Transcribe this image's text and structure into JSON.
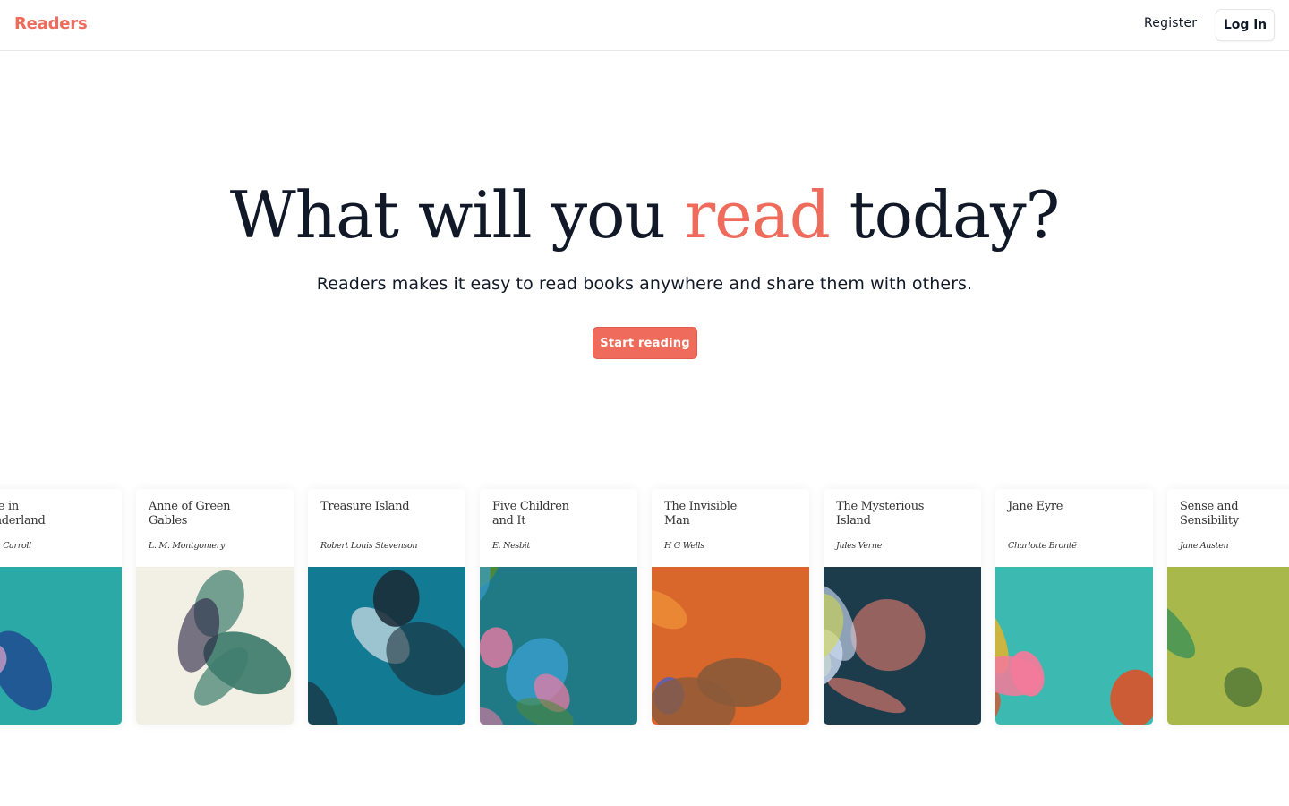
{
  "nav": {
    "brand": "Readers",
    "register_label": "Register",
    "login_label": "Log in"
  },
  "hero": {
    "title_before": "What will you ",
    "title_accent": "read",
    "title_after": " today?",
    "subtitle": "Readers makes it easy to read books anywhere and share them with others.",
    "cta_label": "Start reading"
  },
  "colors": {
    "accent": "#ef6b5c",
    "text": "#111827",
    "border": "#e5e7eb"
  },
  "books": [
    {
      "title": "Alice in Wonderland",
      "author": "Lewis Carroll",
      "cover_palette": [
        "#2aa9a6",
        "#e2473a",
        "#d59fc8",
        "#1d3a8c",
        "#5cc46a"
      ]
    },
    {
      "title": "Anne of Green Gables",
      "author": "L. M. Montgomery",
      "cover_palette": [
        "#f2efe4",
        "#3f7d6e",
        "#2b2546",
        "#d7e29a",
        "#8c88c2"
      ]
    },
    {
      "title": "Treasure Island",
      "author": "Robert Louis Stevenson",
      "cover_palette": [
        "#137a93",
        "#e9eef2",
        "#1c2a36",
        "#2f98a9",
        "#cfe1e6"
      ]
    },
    {
      "title": "Five Children and It",
      "author": "E. Nesbit",
      "cover_palette": [
        "#1f7a86",
        "#f07aa5",
        "#5a3c92",
        "#4e8a3a",
        "#3a9fd0"
      ]
    },
    {
      "title": "The Invisible Man",
      "author": "H G Wells",
      "cover_palette": [
        "#d9662b",
        "#b3452a",
        "#f29a3a",
        "#5a5fb0",
        "#8c5a3a"
      ]
    },
    {
      "title": "The Mysterious Island",
      "author": "Jules Verne",
      "cover_palette": [
        "#1c3c4c",
        "#d4d74a",
        "#d9786a",
        "#c9d8ee",
        "#127a6a"
      ]
    },
    {
      "title": "Jane Eyre",
      "author": "Charlotte Brontë",
      "cover_palette": [
        "#3cb9b0",
        "#3a1428",
        "#f47a9a",
        "#f4b21f",
        "#e84a1f"
      ]
    },
    {
      "title": "Sense and Sensibility",
      "author": "Jane Austen",
      "cover_palette": [
        "#a9b84a",
        "#3f6b34",
        "#2a8a5a",
        "#1f2fa0",
        "#8fe0d8"
      ]
    }
  ]
}
